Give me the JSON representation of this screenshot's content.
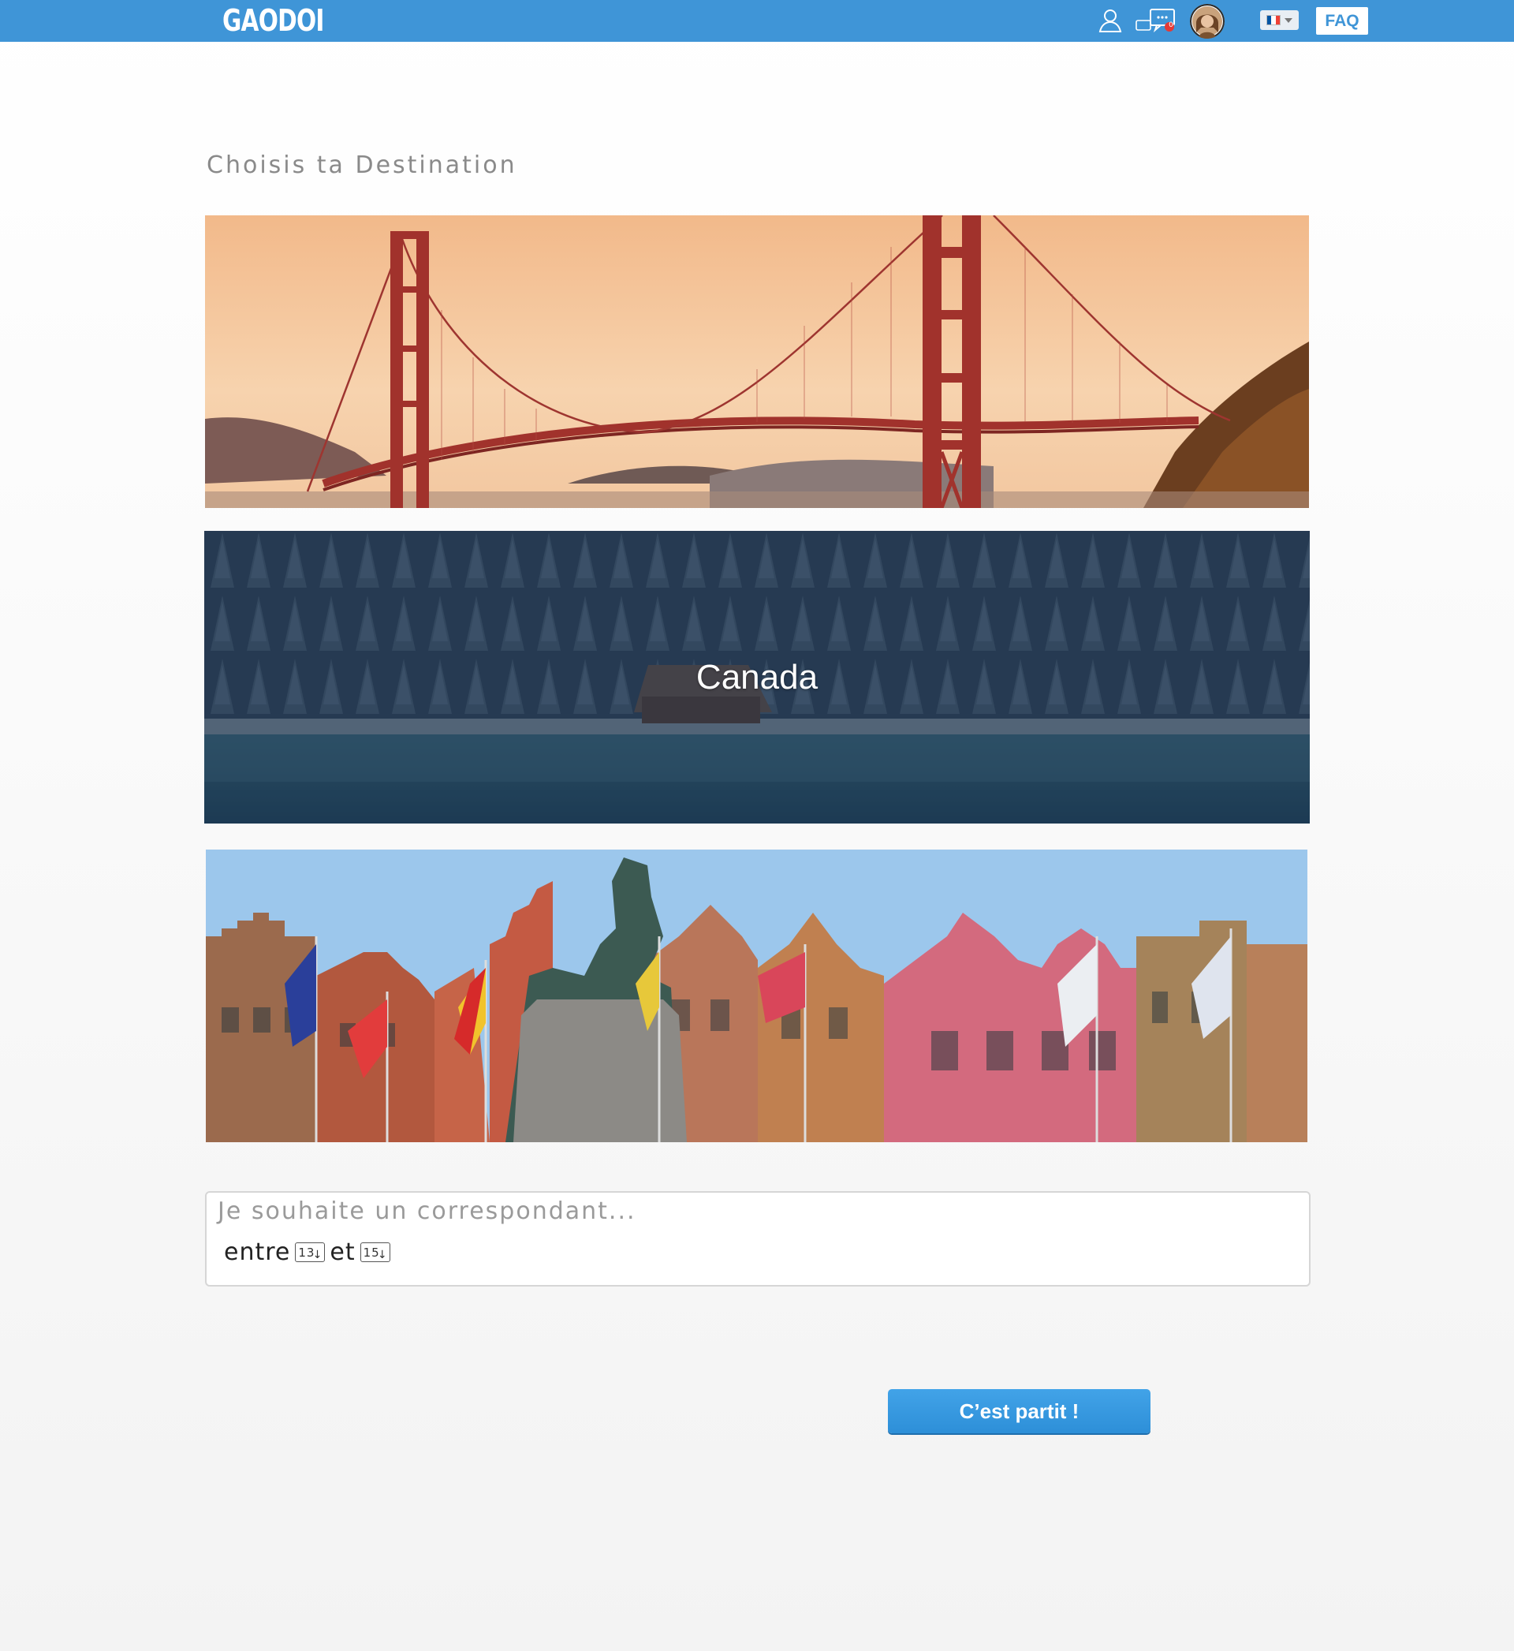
{
  "header": {
    "logo": "GAODOI",
    "messages_badge": "0",
    "faq_label": "FAQ"
  },
  "main": {
    "title": "Choisis ta Destination",
    "destinations": [
      {
        "label": ""
      },
      {
        "label": "Canada"
      },
      {
        "label": ""
      }
    ]
  },
  "preferences": {
    "title": "Je souhaite un correspondant...",
    "between_label": "entre",
    "and_label": "et",
    "age_min": "13",
    "age_max": "15"
  },
  "submit_label": "C’est partit !",
  "colors": {
    "brand": "#3f95d7",
    "button": "#3598e0"
  },
  "icons": [
    "profile-icon",
    "messages-icon",
    "avatar",
    "flag-fr-icon",
    "chevron-down-icon"
  ]
}
